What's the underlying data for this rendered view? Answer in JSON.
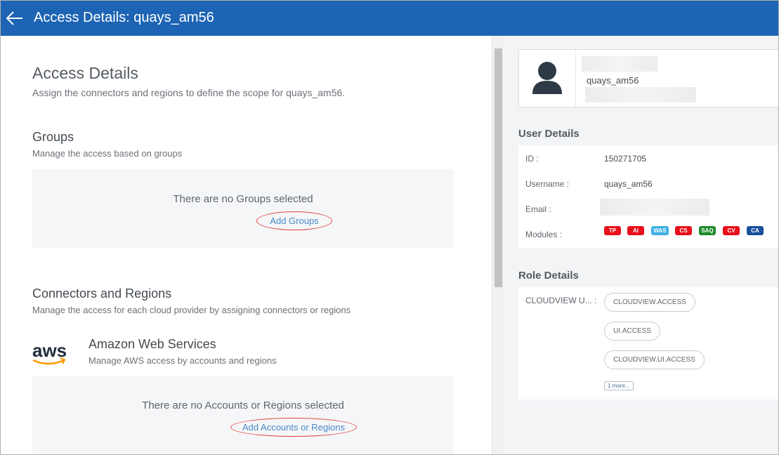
{
  "header": {
    "title": "Access Details: quays_am56"
  },
  "main": {
    "heading": "Access Details",
    "subheading": "Assign the connectors and regions to define the scope for quays_am56.",
    "groups": {
      "title": "Groups",
      "subtitle": "Manage the access based on groups",
      "empty_text": "There are no Groups selected",
      "add_label": "Add Groups"
    },
    "connectors": {
      "title": "Connectors and Regions",
      "subtitle": "Manage the access for each cloud provider by assigning connectors or regions"
    },
    "aws": {
      "logo_text": "aws",
      "title": "Amazon Web Services",
      "subtitle": "Manage AWS access by accounts and regions",
      "empty_text": "There are no Accounts or Regions selected",
      "add_label": "Add Accounts or Regions"
    }
  },
  "profile": {
    "username": "quays_am56"
  },
  "user_details": {
    "title": "User Details",
    "id_label": "ID :",
    "id_value": "150271705",
    "username_label": "Username :",
    "username_value": "quays_am56",
    "email_label": "Email :",
    "modules_label": "Modules :",
    "modules": [
      {
        "label": "TP",
        "color": "#e8101a"
      },
      {
        "label": "AI",
        "color": "#e8101a"
      },
      {
        "label": "WAS",
        "color": "#3fb0e6"
      },
      {
        "label": "CS",
        "color": "#e8101a"
      },
      {
        "label": "SAQ",
        "color": "#1f8a2e"
      },
      {
        "label": "CV",
        "color": "#e8101a"
      },
      {
        "label": "CA",
        "color": "#1a4f9c"
      }
    ]
  },
  "role_details": {
    "title": "Role Details",
    "role_label": "CLOUDVIEW U... :",
    "permissions": [
      "CLOUDVIEW.ACCESS",
      "UI.ACCESS",
      "CLOUDVIEW.UI.ACCESS"
    ],
    "more_label": "1 more..."
  },
  "colors": {
    "header_bg": "#1d64b4",
    "link": "#4a89c8",
    "highlight_oval": "#e0453e",
    "aws_orange": "#ff9900"
  }
}
